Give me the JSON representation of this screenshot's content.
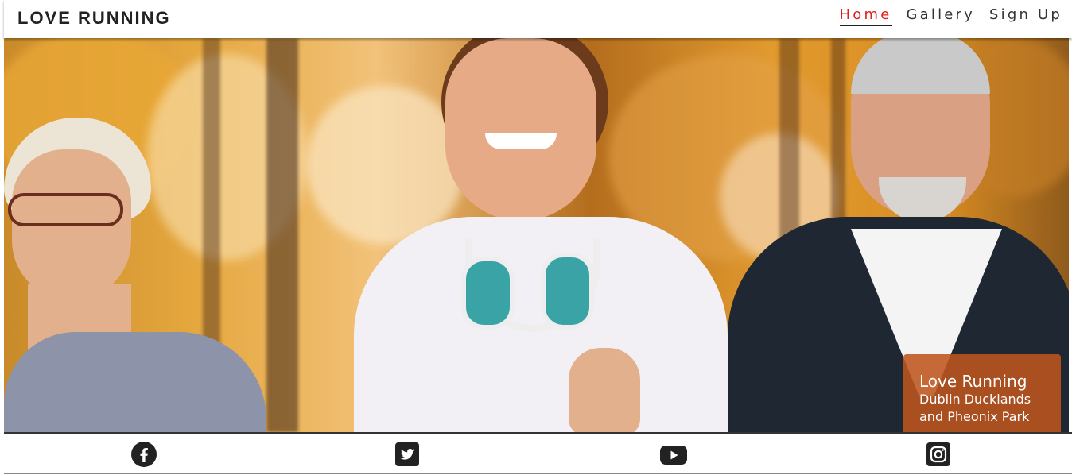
{
  "header": {
    "brand": "LOVE RUNNING",
    "nav": [
      {
        "label": "Home",
        "active": true
      },
      {
        "label": "Gallery",
        "active": false
      },
      {
        "label": "Sign Up",
        "active": false
      }
    ]
  },
  "hero": {
    "caption_title": "Love Running",
    "caption_line1": "Dublin Ducklands",
    "caption_line2": "and Pheonix Park"
  },
  "footer": {
    "icons": [
      "facebook-icon",
      "twitter-icon",
      "youtube-icon",
      "instagram-icon"
    ]
  },
  "colors": {
    "nav_active": "#e0201b",
    "caption_bg": "#be551e"
  }
}
